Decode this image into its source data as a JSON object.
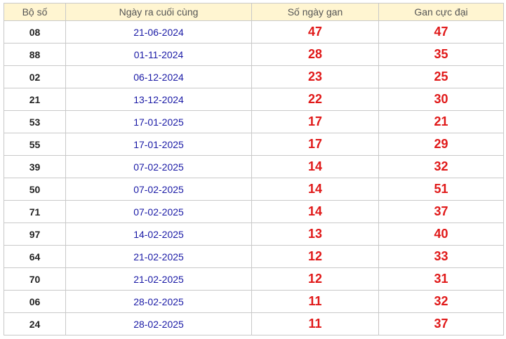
{
  "table": {
    "headers": [
      "Bộ số",
      "Ngày ra cuối cùng",
      "Số ngày gan",
      "Gan cực đại"
    ],
    "rows": [
      [
        "08",
        "21-06-2024",
        "47",
        "47"
      ],
      [
        "88",
        "01-11-2024",
        "28",
        "35"
      ],
      [
        "02",
        "06-12-2024",
        "23",
        "25"
      ],
      [
        "21",
        "13-12-2024",
        "22",
        "30"
      ],
      [
        "53",
        "17-01-2025",
        "17",
        "21"
      ],
      [
        "55",
        "17-01-2025",
        "17",
        "29"
      ],
      [
        "39",
        "07-02-2025",
        "14",
        "32"
      ],
      [
        "50",
        "07-02-2025",
        "14",
        "51"
      ],
      [
        "71",
        "07-02-2025",
        "14",
        "37"
      ],
      [
        "97",
        "14-02-2025",
        "13",
        "40"
      ],
      [
        "64",
        "21-02-2025",
        "12",
        "33"
      ],
      [
        "70",
        "21-02-2025",
        "12",
        "31"
      ],
      [
        "06",
        "28-02-2025",
        "11",
        "32"
      ],
      [
        "24",
        "28-02-2025",
        "11",
        "37"
      ]
    ]
  },
  "colors": {
    "header_bg": "#fff5d1",
    "date_text": "#1a1aa6",
    "gan_text": "#e01818",
    "border": "#c9c9c9"
  }
}
